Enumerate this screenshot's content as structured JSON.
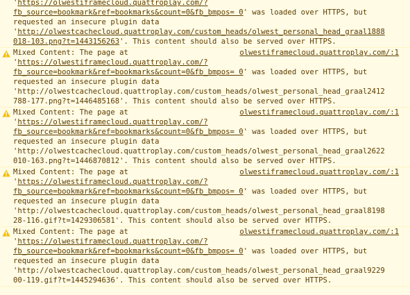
{
  "colors": {
    "background": "#fffbe5",
    "text": "#5c3c00",
    "warning_icon": "#f4bd00",
    "separator": "#fff5c2"
  },
  "messages": [
    {
      "partial": true,
      "icon": "warning-icon",
      "lines": [
        {
          "pre": "'",
          "link": "https://olwestiframecloud.quattroplay.com/?",
          "post": ""
        },
        {
          "pre": "",
          "link": "fb_source=bookmark&ref=bookmarks&count=0&fb_bmpos= 0",
          "post": "' was loaded over HTTPS, but"
        },
        {
          "pre": "requested an insecure plugin data",
          "link": "",
          "post": ""
        },
        {
          "pre": "'",
          "link": "http://olwestcachecloud.quattroplay.com/custom_heads/olwest_personal_head_graal1888",
          "post": ""
        },
        {
          "pre": "",
          "link": "018-103.png?t=1443156263",
          "post": "'. This content should also be served over HTTPS."
        }
      ]
    },
    {
      "partial": false,
      "icon": "warning-icon",
      "title": "Mixed Content: The page at",
      "source": "olwestiframecloud.quattroplay.com/:1",
      "lines": [
        {
          "pre": "'",
          "link": "https://olwestiframecloud.quattroplay.com/?",
          "post": ""
        },
        {
          "pre": "",
          "link": "fb_source=bookmark&ref=bookmarks&count=0&fb_bmpos= 0",
          "post": "' was loaded over HTTPS, but"
        },
        {
          "pre": "requested an insecure plugin data",
          "link": "",
          "post": ""
        },
        {
          "pre": "'http://olwestcachecloud.quattroplay.com/custom_heads/olwest_personal_head_graal2412",
          "link": "",
          "post": ""
        },
        {
          "pre": "788-177.png?t=1446485168'. This content should also be served over HTTPS.",
          "link": "",
          "post": ""
        }
      ]
    },
    {
      "partial": false,
      "icon": "warning-icon",
      "title": "Mixed Content: The page at",
      "source": "olwestiframecloud.quattroplay.com/:1",
      "lines": [
        {
          "pre": "'",
          "link": "https://olwestiframecloud.quattroplay.com/?",
          "post": ""
        },
        {
          "pre": "",
          "link": "fb_source=bookmark&ref=bookmarks&count=0&fb_bmpos= 0",
          "post": "' was loaded over HTTPS, but"
        },
        {
          "pre": "requested an insecure plugin data",
          "link": "",
          "post": ""
        },
        {
          "pre": "'http://olwestcachecloud.quattroplay.com/custom_heads/olwest_personal_head_graal2622",
          "link": "",
          "post": ""
        },
        {
          "pre": "010-163.png?t=1446870812'. This content should also be served over HTTPS.",
          "link": "",
          "post": ""
        }
      ]
    },
    {
      "partial": false,
      "icon": "warning-icon",
      "title": "Mixed Content: The page at",
      "source": "olwestiframecloud.quattroplay.com/:1",
      "lines": [
        {
          "pre": "'",
          "link": "https://olwestiframecloud.quattroplay.com/?",
          "post": ""
        },
        {
          "pre": "",
          "link": "fb_source=bookmark&ref=bookmarks&count=0&fb_bmpos= 0",
          "post": "' was loaded over HTTPS, but"
        },
        {
          "pre": "requested an insecure plugin data",
          "link": "",
          "post": ""
        },
        {
          "pre": "'http://olwestcachecloud.quattroplay.com/custom_heads/olwest_personal_head_graal8198",
          "link": "",
          "post": ""
        },
        {
          "pre": "28-116.gif?t=1429306581'. This content should also be served over HTTPS.",
          "link": "",
          "post": ""
        }
      ]
    },
    {
      "partial": false,
      "icon": "warning-icon",
      "title": "Mixed Content: The page at",
      "source": "olwestiframecloud.quattroplay.com/:1",
      "lines": [
        {
          "pre": "'",
          "link": "https://olwestiframecloud.quattroplay.com/?",
          "post": ""
        },
        {
          "pre": "",
          "link": "fb_source=bookmark&ref=bookmarks&count=0&fb_bmpos= 0",
          "post": "' was loaded over HTTPS, but"
        },
        {
          "pre": "requested an insecure plugin data",
          "link": "",
          "post": ""
        },
        {
          "pre": "'http://olwestcachecloud.quattroplay.com/custom_heads/olwest_personal_head_graal9229",
          "link": "",
          "post": ""
        },
        {
          "pre": "00-119.gif?t=1445294636'. This content should also be served over HTTPS.",
          "link": "",
          "post": ""
        }
      ]
    }
  ]
}
